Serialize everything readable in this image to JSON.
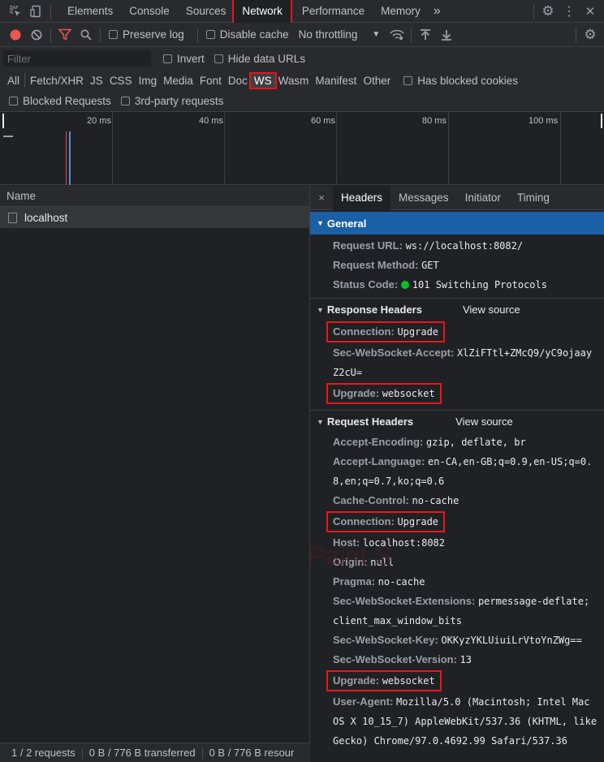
{
  "tabbar": {
    "tabs": [
      "Elements",
      "Console",
      "Sources",
      "Network",
      "Performance",
      "Memory"
    ],
    "active_index": 3,
    "more_label": "»"
  },
  "toolbar": {
    "preserve_log": "Preserve log",
    "disable_cache": "Disable cache",
    "throttling": "No throttling"
  },
  "filterbar": {
    "filter_placeholder": "Filter",
    "invert": "Invert",
    "hide_data_urls": "Hide data URLs"
  },
  "typebar": {
    "types": [
      "All",
      "Fetch/XHR",
      "JS",
      "CSS",
      "Img",
      "Media",
      "Font",
      "Doc",
      "WS",
      "Wasm",
      "Manifest",
      "Other"
    ],
    "active": "WS",
    "has_blocked_cookies": "Has blocked cookies"
  },
  "optbar": {
    "blocked_requests": "Blocked Requests",
    "third_party": "3rd-party requests"
  },
  "timeline": {
    "ticks": [
      "20 ms",
      "40 ms",
      "60 ms",
      "80 ms",
      "100 ms"
    ]
  },
  "request_list": {
    "header": "Name",
    "rows": [
      "localhost"
    ]
  },
  "statusbar": {
    "requests": "1 / 2 requests",
    "transferred": "0 B / 776 B transferred",
    "resources": "0 B / 776 B resour"
  },
  "details": {
    "close": "×",
    "tabs": [
      "Headers",
      "Messages",
      "Initiator",
      "Timing"
    ],
    "active_tab": "Headers",
    "general": {
      "title": "General",
      "request_url_k": "Request URL:",
      "request_url_v": "ws://localhost:8082/",
      "request_method_k": "Request Method:",
      "request_method_v": "GET",
      "status_code_k": "Status Code:",
      "status_code_v": "101 Switching Protocols"
    },
    "response": {
      "title": "Response Headers",
      "view_source": "View source",
      "connection_k": "Connection:",
      "connection_v": "Upgrade",
      "accept_k": "Sec-WebSocket-Accept:",
      "accept_v1": "XlZiFTtl+ZMcQ9/yC9ojaay",
      "accept_v2": "Z2cU=",
      "upgrade_k": "Upgrade:",
      "upgrade_v": "websocket"
    },
    "request": {
      "title": "Request Headers",
      "view_source": "View source",
      "accept_encoding_k": "Accept-Encoding:",
      "accept_encoding_v": "gzip, deflate, br",
      "accept_language_k": "Accept-Language:",
      "accept_language_v1": "en-CA,en-GB;q=0.9,en-US;q=0.",
      "accept_language_v2": "8,en;q=0.7,ko;q=0.6",
      "cache_control_k": "Cache-Control:",
      "cache_control_v": "no-cache",
      "connection_k": "Connection:",
      "connection_v": "Upgrade",
      "host_k": "Host:",
      "host_v": "localhost:8082",
      "origin_k": "Origin:",
      "origin_v": "null",
      "pragma_k": "Pragma:",
      "pragma_v": "no-cache",
      "extensions_k": "Sec-WebSocket-Extensions:",
      "extensions_v1": "permessage-deflate;",
      "extensions_v2": "client_max_window_bits",
      "key_k": "Sec-WebSocket-Key:",
      "key_v": "OKKyzYKLUiuiLrVtoYnZWg==",
      "version_k": "Sec-WebSocket-Version:",
      "version_v": "13",
      "upgrade_k": "Upgrade:",
      "upgrade_v": "websocket",
      "user_agent_k": "User-Agent:",
      "user_agent_v1": "Mozilla/5.0 (Macintosh; Intel Mac",
      "user_agent_v2": "OS X 10_15_7) AppleWebKit/537.36 (KHTML, like",
      "user_agent_v3": "Gecko) Chrome/97.0.4692.99 Safari/537.36"
    }
  },
  "watermark": "Created by Paint S",
  "colors": {
    "highlight": "#e8161a",
    "selected_section": "#1b5fa6",
    "record": "#ee5454",
    "status_ok": "#0ebf2e"
  }
}
